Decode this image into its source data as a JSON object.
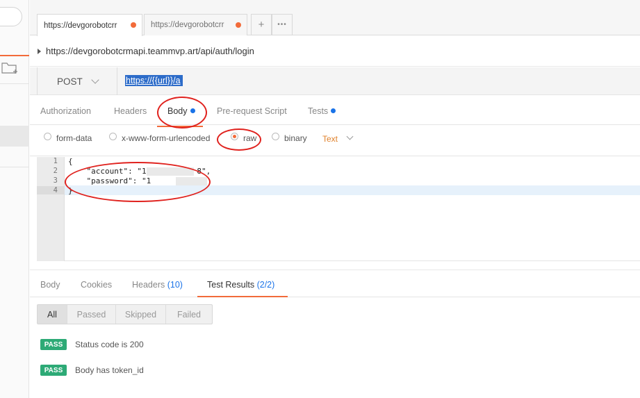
{
  "tabs": [
    {
      "label": "https://devgorobotcrr",
      "active": true,
      "unsaved": true
    },
    {
      "label": "https://devgorobotcrr",
      "active": false,
      "unsaved": true
    }
  ],
  "tab_actions": {
    "add_icon": "+",
    "more_icon": "•••"
  },
  "request": {
    "title": "https://devgorobotcrmapi.teammvp.art/api/auth/login",
    "method": "POST",
    "url": "https://{{url}}/a"
  },
  "request_tabs": [
    {
      "label": "Authorization"
    },
    {
      "label": "Headers"
    },
    {
      "label": "Body",
      "active": true,
      "dot": true
    },
    {
      "label": "Pre-request Script"
    },
    {
      "label": "Tests",
      "dot": true
    }
  ],
  "body_types": [
    {
      "label": "form-data",
      "selected": false
    },
    {
      "label": "x-www-form-urlencoded",
      "selected": false
    },
    {
      "label": "raw",
      "selected": true
    },
    {
      "label": "binary",
      "selected": false
    }
  ],
  "raw_format": "Text",
  "editor": {
    "line_numbers": [
      "1",
      "2",
      "3",
      "4"
    ],
    "lines": [
      "{",
      "    \"account\": \"15          8\",",
      "    \"password\": \"1",
      "}"
    ]
  },
  "response_tabs": [
    {
      "label": "Body"
    },
    {
      "label": "Cookies"
    },
    {
      "label": "Headers",
      "count": "(10)"
    },
    {
      "label": "Test Results",
      "count": "(2/2)",
      "active": true
    }
  ],
  "filters": [
    "All",
    "Passed",
    "Skipped",
    "Failed"
  ],
  "results": [
    {
      "status": "PASS",
      "text": "Status code is 200"
    },
    {
      "status": "PASS",
      "text": "Body has token_id"
    }
  ],
  "colors": {
    "accent": "#f26b3a",
    "link_blue": "#1a73e8",
    "pass_green": "#2daa76",
    "annotation_red": "#e0221e"
  }
}
